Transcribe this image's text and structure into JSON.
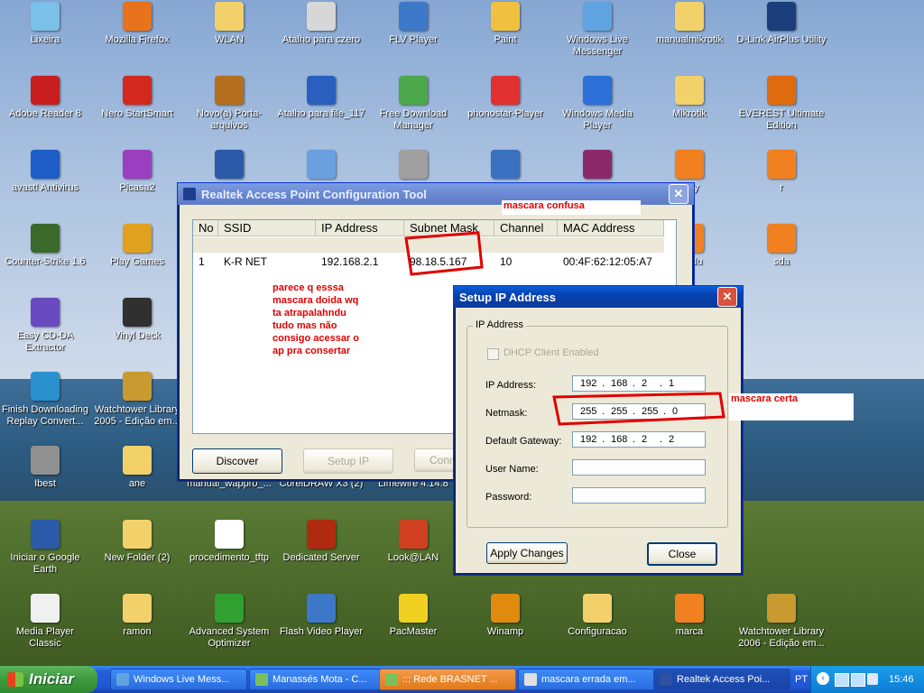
{
  "desktop_icons": [
    {
      "label": "Lixeira",
      "icon": "recycle-bin-icon",
      "color": "#7ac0e8"
    },
    {
      "label": "Mozilla Firefox",
      "icon": "firefox-icon",
      "color": "#e8731c"
    },
    {
      "label": "WLAN",
      "icon": "folder-icon",
      "color": "#f2d16b"
    },
    {
      "label": "Atalho para czero",
      "icon": "shortcut-window-icon",
      "color": "#d7d7d7"
    },
    {
      "label": "FLV Player",
      "icon": "flv-player-icon",
      "color": "#3e78c8"
    },
    {
      "label": "Paint",
      "icon": "paint-icon",
      "color": "#f0c040"
    },
    {
      "label": "Windows Live Messenger",
      "icon": "messenger-icon",
      "color": "#5fa4e0"
    },
    {
      "label": "manualmikrotik",
      "icon": "zip-folder-icon",
      "color": "#f2d16b"
    },
    {
      "label": "D-Link AirPlus Utility",
      "icon": "dlink-icon",
      "color": "#1b3d7a"
    },
    {
      "label": "Adobe Reader 8",
      "icon": "adobe-reader-icon",
      "color": "#c81e1e"
    },
    {
      "label": "Nero StartSmart",
      "icon": "nero-icon",
      "color": "#d2281e"
    },
    {
      "label": "Novo(a) Porta-arquivos",
      "icon": "briefcase-icon",
      "color": "#b46e1e"
    },
    {
      "label": "Atalho para file_117",
      "icon": "network-icon",
      "color": "#2a5fc0"
    },
    {
      "label": "Free Download Manager",
      "icon": "download-manager-icon",
      "color": "#4aa84a"
    },
    {
      "label": "phonostar-Player",
      "icon": "phonostar-icon",
      "color": "#e03030"
    },
    {
      "label": "Windows Media Player",
      "icon": "media-player-icon",
      "color": "#2a70d8"
    },
    {
      "label": "Mikrotik",
      "icon": "zip-folder-icon",
      "color": "#f2d16b"
    },
    {
      "label": "EVEREST Ultimate Edition",
      "icon": "everest-icon",
      "color": "#e06a10"
    },
    {
      "label": "avast! Antivirus",
      "icon": "avast-icon",
      "color": "#1e5cc8"
    },
    {
      "label": "Picasa2",
      "icon": "picasa-icon",
      "color": "#9a3fc0"
    },
    {
      "label": "Counter-Strike 1.6",
      "icon": "counter-strike-icon",
      "color": "#3a6a2a"
    },
    {
      "label": "Play Games",
      "icon": "play-games-icon",
      "color": "#e0a020"
    },
    {
      "label": "Easy CD-DA Extractor",
      "icon": "cd-extractor-icon",
      "color": "#6a4ac0"
    },
    {
      "label": "Vinyl Deck",
      "icon": "vinyl-deck-icon",
      "color": "#303030"
    },
    {
      "label": "Finish Downloading Replay Convert...",
      "icon": "replay-converter-icon",
      "color": "#2a90d0"
    },
    {
      "label": "Watchtower Library 2005 - Edição em...",
      "icon": "watchtower-icon",
      "color": "#c89a30"
    },
    {
      "label": "Ibest",
      "icon": "ibest-icon",
      "color": "#909090"
    },
    {
      "label": "ane",
      "icon": "folder-icon",
      "color": "#f2d16b"
    },
    {
      "label": "manual_wappro_...",
      "icon": "document-icon",
      "color": "#ffffff"
    },
    {
      "label": "CorelDRAW X3 (2)",
      "icon": "document-icon",
      "color": "#ffffff"
    },
    {
      "label": "Limewire 4.14.8",
      "icon": "document-icon",
      "color": "#ffffff"
    },
    {
      "label": "Iniciar o Google Earth",
      "icon": "google-earth-icon",
      "color": "#2a5aa8"
    },
    {
      "label": "New Folder (2)",
      "icon": "folder-icon",
      "color": "#f2d16b"
    },
    {
      "label": "procedimento_tftp",
      "icon": "pdf-icon",
      "color": "#ffffff"
    },
    {
      "label": "Dedicated Server",
      "icon": "half-life-icon",
      "color": "#b02a10"
    },
    {
      "label": "Look@LAN",
      "icon": "lookatlan-icon",
      "color": "#d04020"
    },
    {
      "label": "Media Player Classic",
      "icon": "clapperboard-icon",
      "color": "#f0f0f0"
    },
    {
      "label": "ramon",
      "icon": "folder-icon",
      "color": "#f2d16b"
    },
    {
      "label": "Advanced System Optimizer",
      "icon": "optimizer-icon",
      "color": "#30a030"
    },
    {
      "label": "Flash Video Player",
      "icon": "flv-player-icon",
      "color": "#3e78c8"
    },
    {
      "label": "PacMaster",
      "icon": "pacman-icon",
      "color": "#f0d020"
    },
    {
      "label": "Winamp",
      "icon": "winamp-icon",
      "color": "#e08a10"
    },
    {
      "label": "Configuracao",
      "icon": "zip-folder-icon",
      "color": "#f2d16b"
    },
    {
      "label": "marca",
      "icon": "image-file-icon",
      "color": "#f08020"
    },
    {
      "label": "Watchtower Library 2006 - Edição em...",
      "icon": "watchtower-icon",
      "color": "#c89a30"
    },
    {
      "label": "rvey",
      "icon": "image-file-icon",
      "color": "#f08020"
    },
    {
      "label": "r",
      "icon": "image-file-icon",
      "color": "#f08020"
    },
    {
      "label": "licadu",
      "icon": "image-file-icon",
      "color": "#f08020"
    },
    {
      "label": "sda",
      "icon": "image-file-icon",
      "color": "#f08020"
    },
    {
      "label": "",
      "icon": "google-earth-icon",
      "color": "#2a5aa8"
    },
    {
      "label": "",
      "icon": "notepad-icon",
      "color": "#6aa0e0"
    },
    {
      "label": "",
      "icon": "person-icon",
      "color": "#a0a0a0"
    },
    {
      "label": "",
      "icon": "network-tool-icon",
      "color": "#3a70c0"
    },
    {
      "label": "",
      "icon": "winrar-icon",
      "color": "#8a2a6a"
    }
  ],
  "realtek_window": {
    "title": "Realtek Access Point Configuration Tool",
    "columns": [
      "No",
      "SSID",
      "IP Address",
      "Subnet Mask",
      "Channel",
      "MAC Address"
    ],
    "row": [
      "1",
      "K-R NET",
      "192.168.2.1",
      "98.18.5.167",
      "10",
      "00:4F:62:12:05:A7"
    ],
    "buttons": {
      "discover": "Discover",
      "setup_ip": "Setup IP",
      "connect": "Conn"
    }
  },
  "setup_window": {
    "title": "Setup IP Address",
    "group_label": "IP Address",
    "dhcp_label": "DHCP Client Enabled",
    "fields": {
      "ip_label": "IP Address:",
      "ip": [
        "192",
        "168",
        "2",
        "1"
      ],
      "netmask_label": "Netmask:",
      "netmask": [
        "255",
        "255",
        "255",
        "0"
      ],
      "gateway_label": "Default Gateway:",
      "gateway": [
        "192",
        "168",
        "2",
        "2"
      ],
      "user_label": "User Name:",
      "user": "",
      "password_label": "Password:",
      "password": ""
    },
    "buttons": {
      "apply": "Apply Changes",
      "close": "Close"
    }
  },
  "annotations": {
    "mascara_confusa": "mascara confusa",
    "mascara_certa": "mascara certa",
    "comment_lines": [
      "parece q esssa",
      "mascara doida wq",
      "ta atrapalahndu",
      "tudo mas não",
      "consigo acessar o",
      "ap pra consertar"
    ]
  },
  "taskbar": {
    "start": "Iniciar",
    "tasks": [
      {
        "label": "Windows Live Mess...",
        "color": "#5fa4e0",
        "state": "normal"
      },
      {
        "label": "Manassés Mota - C...",
        "color": "#7ac05a",
        "state": "normal"
      },
      {
        "label": "::: Rede BRASNET ...",
        "color": "#7ac05a",
        "state": "highlight"
      },
      {
        "label": "mascara errada em...",
        "color": "#e0e0e0",
        "state": "normal"
      },
      {
        "label": "Realtek Access Poi...",
        "color": "#3050a0",
        "state": "active"
      }
    ],
    "language": "PT",
    "clock": "15:46"
  }
}
